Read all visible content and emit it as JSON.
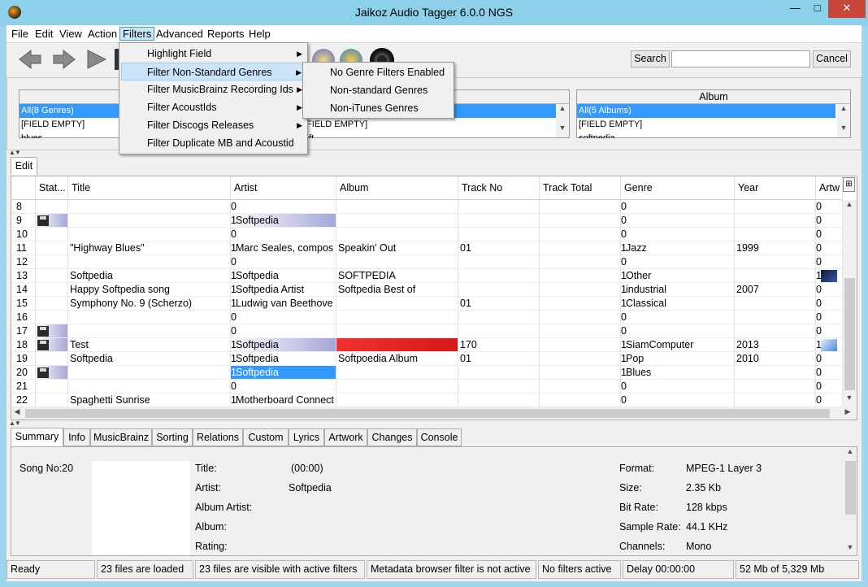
{
  "window": {
    "title": "Jaikoz Audio Tagger 6.0.0 NGS"
  },
  "menubar": [
    "File",
    "Edit",
    "View",
    "Action",
    "Filters",
    "Advanced",
    "Reports",
    "Help"
  ],
  "toolbar": {
    "search_label": "Search",
    "search_value": "",
    "cancel_label": "Cancel"
  },
  "browser": {
    "genre_items": [
      "All(8 Genres)",
      "[FIELD EMPTY]",
      "blues"
    ],
    "artist_items": [
      "[FIELD EMPTY]",
      "oft"
    ],
    "album_title": "Album",
    "album_items": [
      "All(5 Albums)",
      "[FIELD EMPTY]",
      "softpedia"
    ]
  },
  "filters_menu": [
    "Highlight Field",
    "Filter Non-Standard Genres",
    "Filter MusicBrainz Recording Ids",
    "Filter AcoustIds",
    "Filter Discogs Releases",
    "Filter Duplicate MB and Acoustid"
  ],
  "genres_submenu": [
    "No Genre Filters Enabled",
    "Non-standard Genres",
    "Non-iTunes Genres"
  ],
  "edit_tab": "Edit",
  "grid": {
    "columns": [
      "Stat...",
      "Title",
      "Artist",
      "Album",
      "Track No",
      "Track Total",
      "Genre",
      "Year",
      "Artw"
    ],
    "rows": [
      {
        "no": "8",
        "disk": false,
        "title": "",
        "af": "0",
        "artist": "",
        "album": "",
        "track": "",
        "total": "",
        "gf": "0",
        "genre": "",
        "year": "",
        "wf": "0"
      },
      {
        "no": "9",
        "disk": true,
        "title": "",
        "af": "1",
        "artist": "Softpedia",
        "album": "",
        "track": "",
        "total": "",
        "gf": "0",
        "genre": "",
        "year": "",
        "wf": "0"
      },
      {
        "no": "10",
        "disk": false,
        "title": "",
        "af": "0",
        "artist": "",
        "album": "",
        "track": "",
        "total": "",
        "gf": "0",
        "genre": "",
        "year": "",
        "wf": "0"
      },
      {
        "no": "11",
        "disk": false,
        "title": "\"Highway Blues\"",
        "af": "1",
        "artist": "Marc Seales, compos",
        "album": "Speakin' Out",
        "track": "01",
        "total": "",
        "gf": "1",
        "genre": "Jazz",
        "year": "1999",
        "wf": "0"
      },
      {
        "no": "12",
        "disk": false,
        "title": "",
        "af": "0",
        "artist": "",
        "album": "",
        "track": "",
        "total": "",
        "gf": "0",
        "genre": "",
        "year": "",
        "wf": "0"
      },
      {
        "no": "13",
        "disk": false,
        "title": "Softpedia",
        "af": "1",
        "artist": "Softpedia",
        "album": "SOFTPEDIA",
        "track": "",
        "total": "",
        "gf": "1",
        "genre": "Other",
        "year": "",
        "wf": "1"
      },
      {
        "no": "14",
        "disk": false,
        "title": "Happy Softpedia song",
        "af": "1",
        "artist": "Softpedia Artist",
        "album": "Softpedia Best of",
        "track": "",
        "total": "",
        "gf": "1",
        "genre": "industrial",
        "year": "2007",
        "wf": "0"
      },
      {
        "no": "15",
        "disk": false,
        "title": "Symphony No. 9 (Scherzo)",
        "af": "1",
        "artist": "Ludwig van Beethove",
        "album": "",
        "track": "01",
        "total": "",
        "gf": "1",
        "genre": "Classical",
        "year": "",
        "wf": "0"
      },
      {
        "no": "16",
        "disk": false,
        "title": "",
        "af": "0",
        "artist": "",
        "album": "",
        "track": "",
        "total": "",
        "gf": "0",
        "genre": "",
        "year": "",
        "wf": "0"
      },
      {
        "no": "17",
        "disk": true,
        "title": "",
        "af": "0",
        "artist": "",
        "album": "",
        "track": "",
        "total": "",
        "gf": "0",
        "genre": "",
        "year": "",
        "wf": "0"
      },
      {
        "no": "18",
        "disk": true,
        "title": "Test",
        "af": "1",
        "artist": "Softpedia",
        "album": "",
        "track": "170",
        "total": "",
        "gf": "1",
        "genre": "SiamComputer",
        "year": "2013",
        "wf": "1"
      },
      {
        "no": "19",
        "disk": false,
        "title": "Softpedia",
        "af": "1",
        "artist": "Softpedia",
        "album": "Softpoedia Album",
        "track": "01",
        "total": "",
        "gf": "1",
        "genre": "Pop",
        "year": "2010",
        "wf": "0"
      },
      {
        "no": "20",
        "disk": true,
        "title": "",
        "af": "1",
        "artist": "Softpedia",
        "album": "",
        "track": "",
        "total": "",
        "gf": "1",
        "genre": "Blues",
        "year": "",
        "wf": "0"
      },
      {
        "no": "21",
        "disk": false,
        "title": "",
        "af": "0",
        "artist": "",
        "album": "",
        "track": "",
        "total": "",
        "gf": "0",
        "genre": "",
        "year": "",
        "wf": "0"
      },
      {
        "no": "22",
        "disk": false,
        "title": "Spaghetti Sunrise",
        "af": "1",
        "artist": "Motherboard Connect",
        "album": "",
        "track": "",
        "total": "",
        "gf": "0",
        "genre": "",
        "year": "",
        "wf": "0"
      }
    ]
  },
  "bottom_tabs": [
    "Summary",
    "Info",
    "MusicBrainz",
    "Sorting",
    "Relations",
    "Custom",
    "Lyrics",
    "Artwork",
    "Changes",
    "Console"
  ],
  "summary": {
    "song_no": "Song No:20",
    "title_label": "Title:",
    "title_value": "(00:00)",
    "artist_label": "Artist:",
    "artist_value": "Softpedia",
    "album_artist_label": "Album Artist:",
    "album_label": "Album:",
    "rating_label": "Rating:",
    "format_label": "Format:",
    "format_value": "MPEG-1 Layer 3",
    "size_label": "Size:",
    "size_value": "2.35 Kb",
    "bitrate_label": "Bit Rate:",
    "bitrate_value": "128 kbps",
    "samplerate_label": "Sample Rate:",
    "samplerate_value": "44.1 KHz",
    "channels_label": "Channels:",
    "channels_value": "Mono"
  },
  "status": [
    "Ready",
    "23 files are loaded",
    "23 files are visible with active filters",
    "Metadata browser filter is not active",
    "No filters active",
    "Delay 00:00:00",
    "52 Mb of 5,329 Mb"
  ],
  "colors": {
    "selection": "#3399ff",
    "titlebar": "#8dd0ea",
    "close": "#c7453b",
    "menu_highlight": "#cce4f7"
  }
}
